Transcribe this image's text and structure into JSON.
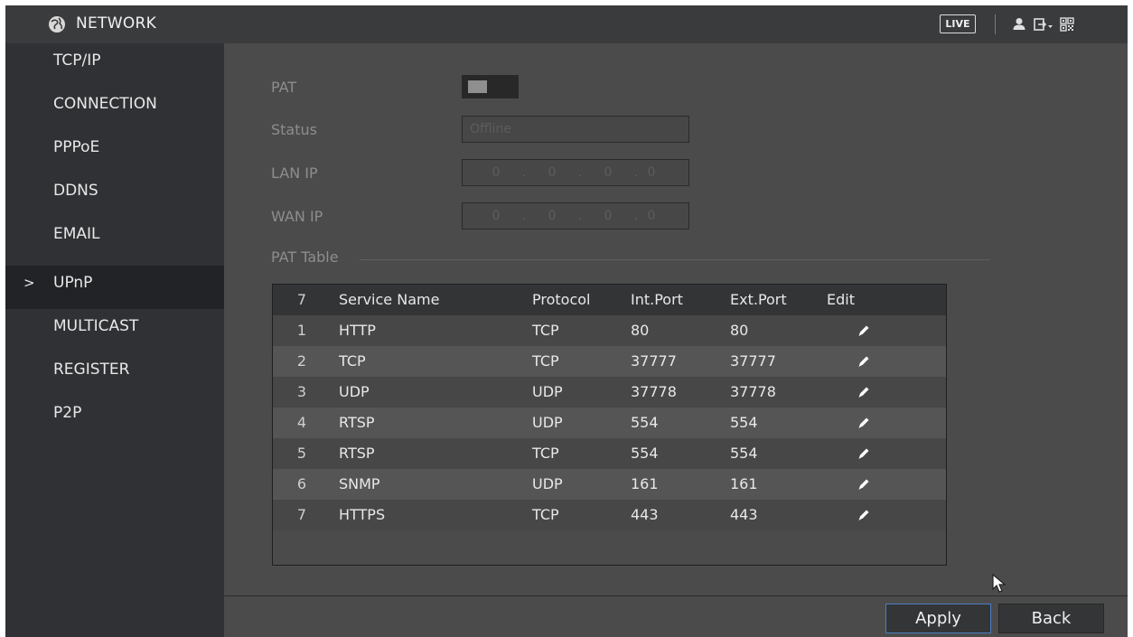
{
  "header": {
    "title": "NETWORK",
    "live_label": "LIVE",
    "icons": [
      "globe-icon",
      "user-icon",
      "logout-icon",
      "qrcode-icon"
    ]
  },
  "sidebar": {
    "items": [
      {
        "label": "TCP/IP"
      },
      {
        "label": "CONNECTION"
      },
      {
        "label": "PPPoE"
      },
      {
        "label": "DDNS"
      },
      {
        "label": "EMAIL"
      },
      {
        "label": "UPnP",
        "active": true,
        "arrow": ">"
      },
      {
        "label": "MULTICAST"
      },
      {
        "label": "REGISTER"
      },
      {
        "label": "P2P"
      }
    ]
  },
  "form": {
    "pat_label": "PAT",
    "pat_enabled": false,
    "status_label": "Status",
    "status_value": "Offline",
    "lan_label": "LAN IP",
    "lan_ip": [
      "0",
      "0",
      "0",
      "0"
    ],
    "wan_label": "WAN IP",
    "wan_ip": [
      "0",
      "0",
      "0",
      "0"
    ]
  },
  "pat_table": {
    "section_title": "PAT Table",
    "headers": {
      "num": "7",
      "service": "Service Name",
      "protocol": "Protocol",
      "int_port": "Int.Port",
      "ext_port": "Ext.Port",
      "edit": "Edit"
    },
    "rows": [
      {
        "num": "1",
        "service": "HTTP",
        "protocol": "TCP",
        "int_port": "80",
        "ext_port": "80"
      },
      {
        "num": "2",
        "service": "TCP",
        "protocol": "TCP",
        "int_port": "37777",
        "ext_port": "37777"
      },
      {
        "num": "3",
        "service": "UDP",
        "protocol": "UDP",
        "int_port": "37778",
        "ext_port": "37778"
      },
      {
        "num": "4",
        "service": "RTSP",
        "protocol": "UDP",
        "int_port": "554",
        "ext_port": "554"
      },
      {
        "num": "5",
        "service": "RTSP",
        "protocol": "TCP",
        "int_port": "554",
        "ext_port": "554"
      },
      {
        "num": "6",
        "service": "SNMP",
        "protocol": "UDP",
        "int_port": "161",
        "ext_port": "161"
      },
      {
        "num": "7",
        "service": "HTTPS",
        "protocol": "TCP",
        "int_port": "443",
        "ext_port": "443"
      }
    ]
  },
  "buttons": {
    "apply": "Apply",
    "back": "Back"
  },
  "colors": {
    "accent": "#4a7fc1",
    "background": "#4b4b4b",
    "sidebar": "#303134",
    "topbar": "#3a3b3d"
  }
}
